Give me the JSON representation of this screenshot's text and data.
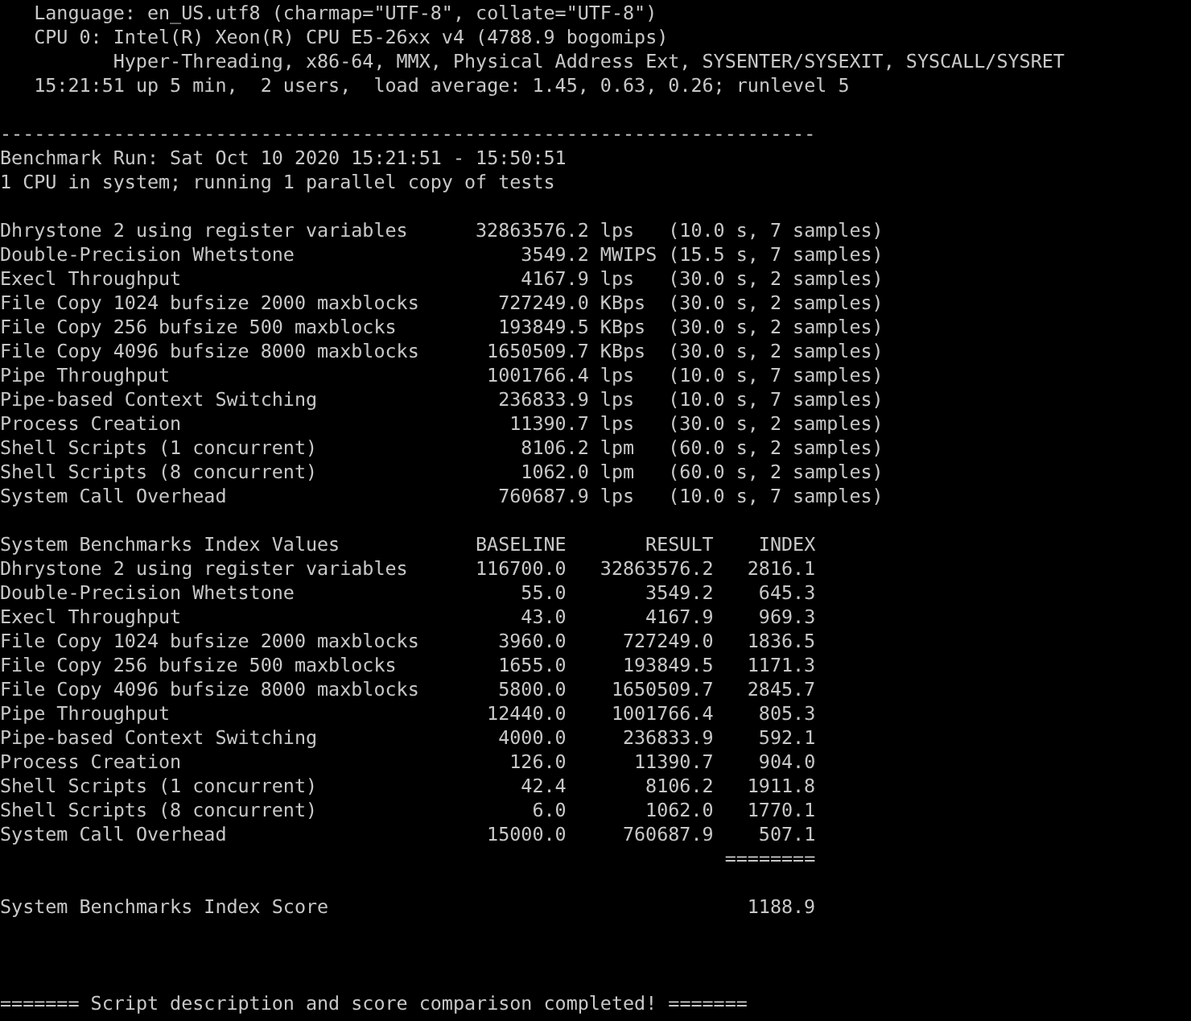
{
  "system_info": [
    {
      "kind": "line",
      "text": "Language: en_US.utf8 (charmap=\"UTF-8\", collate=\"UTF-8\")"
    },
    {
      "kind": "line",
      "text": "CPU 0: Intel(R) Xeon(R) CPU E5-26xx v4 (4788.9 bogomips)"
    },
    {
      "kind": "continuation",
      "text": "Hyper-Threading, x86-64, MMX, Physical Address Ext, SYSENTER/SYSEXIT, SYSCALL/SYSRET"
    },
    {
      "kind": "line",
      "text": "15:21:51 up 5 min,  2 users,  load average: 1.45, 0.63, 0.26; runlevel 5"
    }
  ],
  "separator": "------------------------------------------------------------------------",
  "run_info": [
    "Benchmark Run: Sat Oct 10 2020 15:21:51 - 15:50:51",
    "1 CPU in system; running 1 parallel copy of tests"
  ],
  "results": [
    {
      "name": "Dhrystone 2 using register variables",
      "value": "32863576.2",
      "unit": "lps",
      "detail": "(10.0 s, 7 samples)"
    },
    {
      "name": "Double-Precision Whetstone",
      "value": "3549.2",
      "unit": "MWIPS",
      "detail": "(15.5 s, 7 samples)"
    },
    {
      "name": "Execl Throughput",
      "value": "4167.9",
      "unit": "lps",
      "detail": "(30.0 s, 2 samples)"
    },
    {
      "name": "File Copy 1024 bufsize 2000 maxblocks",
      "value": "727249.0",
      "unit": "KBps",
      "detail": "(30.0 s, 2 samples)"
    },
    {
      "name": "File Copy 256 bufsize 500 maxblocks",
      "value": "193849.5",
      "unit": "KBps",
      "detail": "(30.0 s, 2 samples)"
    },
    {
      "name": "File Copy 4096 bufsize 8000 maxblocks",
      "value": "1650509.7",
      "unit": "KBps",
      "detail": "(30.0 s, 2 samples)"
    },
    {
      "name": "Pipe Throughput",
      "value": "1001766.4",
      "unit": "lps",
      "detail": "(10.0 s, 7 samples)"
    },
    {
      "name": "Pipe-based Context Switching",
      "value": "236833.9",
      "unit": "lps",
      "detail": "(10.0 s, 7 samples)"
    },
    {
      "name": "Process Creation",
      "value": "11390.7",
      "unit": "lps",
      "detail": "(30.0 s, 2 samples)"
    },
    {
      "name": "Shell Scripts (1 concurrent)",
      "value": "8106.2",
      "unit": "lpm",
      "detail": "(60.0 s, 2 samples)"
    },
    {
      "name": "Shell Scripts (8 concurrent)",
      "value": "1062.0",
      "unit": "lpm",
      "detail": "(60.0 s, 2 samples)"
    },
    {
      "name": "System Call Overhead",
      "value": "760687.9",
      "unit": "lps",
      "detail": "(10.0 s, 7 samples)"
    }
  ],
  "index_table": {
    "title": "System Benchmarks Index Values",
    "columns": [
      "BASELINE",
      "RESULT",
      "INDEX"
    ],
    "rows": [
      {
        "name": "Dhrystone 2 using register variables",
        "baseline": "116700.0",
        "result": "32863576.2",
        "index": "2816.1"
      },
      {
        "name": "Double-Precision Whetstone",
        "baseline": "55.0",
        "result": "3549.2",
        "index": "645.3"
      },
      {
        "name": "Execl Throughput",
        "baseline": "43.0",
        "result": "4167.9",
        "index": "969.3"
      },
      {
        "name": "File Copy 1024 bufsize 2000 maxblocks",
        "baseline": "3960.0",
        "result": "727249.0",
        "index": "1836.5"
      },
      {
        "name": "File Copy 256 bufsize 500 maxblocks",
        "baseline": "1655.0",
        "result": "193849.5",
        "index": "1171.3"
      },
      {
        "name": "File Copy 4096 bufsize 8000 maxblocks",
        "baseline": "5800.0",
        "result": "1650509.7",
        "index": "2845.7"
      },
      {
        "name": "Pipe Throughput",
        "baseline": "12440.0",
        "result": "1001766.4",
        "index": "805.3"
      },
      {
        "name": "Pipe-based Context Switching",
        "baseline": "4000.0",
        "result": "236833.9",
        "index": "592.1"
      },
      {
        "name": "Process Creation",
        "baseline": "126.0",
        "result": "11390.7",
        "index": "904.0"
      },
      {
        "name": "Shell Scripts (1 concurrent)",
        "baseline": "42.4",
        "result": "8106.2",
        "index": "1911.8"
      },
      {
        "name": "Shell Scripts (8 concurrent)",
        "baseline": "6.0",
        "result": "1062.0",
        "index": "1770.1"
      },
      {
        "name": "System Call Overhead",
        "baseline": "15000.0",
        "result": "760687.9",
        "index": "507.1"
      }
    ],
    "total_rule": "========",
    "score_label": "System Benchmarks Index Score",
    "score": "1188.9"
  },
  "footer": "======= Script description and score comparison completed! ======="
}
